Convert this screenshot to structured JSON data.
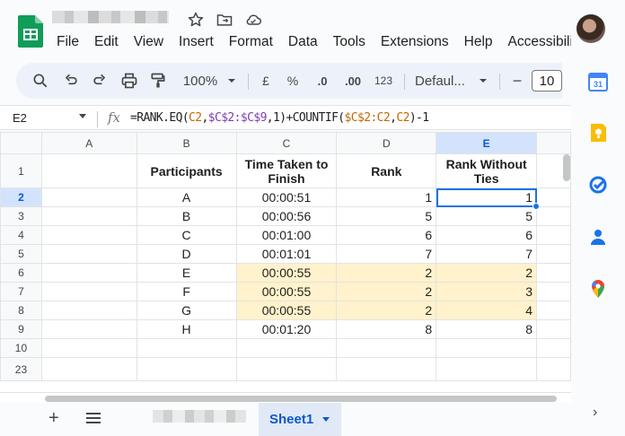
{
  "header": {
    "menu": [
      "File",
      "Edit",
      "View",
      "Insert",
      "Format",
      "Data",
      "Tools",
      "Extensions",
      "Help",
      "Accessibili"
    ]
  },
  "toolbar": {
    "zoom": "100%",
    "currency": "£",
    "percent": "%",
    "decrease_decimal": ".0",
    "increase_decimal": ".00",
    "more_formats": "123",
    "font": "Defaul...",
    "minus": "−",
    "font_size": "10"
  },
  "formula_bar": {
    "cell_ref": "E2",
    "fx": "fx",
    "formula_parts": [
      "=RANK.EQ(",
      "C2",
      ",",
      "$C$2:$C$9",
      ",1)+COUNTIF(",
      "$C$2:C2",
      ",",
      "C2",
      ")-1"
    ]
  },
  "grid": {
    "columns": [
      "A",
      "B",
      "C",
      "D",
      "E"
    ],
    "row_numbers": [
      "1",
      "2",
      "3",
      "4",
      "5",
      "6",
      "7",
      "8",
      "9",
      "10",
      "23"
    ],
    "header_row": [
      "",
      "Participants",
      "Time Taken to Finish",
      "Rank",
      "Rank Without Ties"
    ],
    "rows": [
      {
        "participant": "A",
        "time": "00:00:51",
        "rank": "1",
        "rank_no_ties": "1",
        "highlight": false
      },
      {
        "participant": "B",
        "time": "00:00:56",
        "rank": "5",
        "rank_no_ties": "5",
        "highlight": false
      },
      {
        "participant": "C",
        "time": "00:01:00",
        "rank": "6",
        "rank_no_ties": "6",
        "highlight": false
      },
      {
        "participant": "D",
        "time": "00:01:01",
        "rank": "7",
        "rank_no_ties": "7",
        "highlight": false
      },
      {
        "participant": "E",
        "time": "00:00:55",
        "rank": "2",
        "rank_no_ties": "2",
        "highlight": true
      },
      {
        "participant": "F",
        "time": "00:00:55",
        "rank": "2",
        "rank_no_ties": "3",
        "highlight": true
      },
      {
        "participant": "G",
        "time": "00:00:55",
        "rank": "2",
        "rank_no_ties": "4",
        "highlight": true
      },
      {
        "participant": "H",
        "time": "00:01:20",
        "rank": "8",
        "rank_no_ties": "8",
        "highlight": false
      }
    ]
  },
  "sheets": {
    "add": "+",
    "active_tab": "Sheet1"
  },
  "colors": {
    "highlight": "#fff2cc",
    "selection": "#1a73e8",
    "active_tab": "#e1e9f7"
  }
}
